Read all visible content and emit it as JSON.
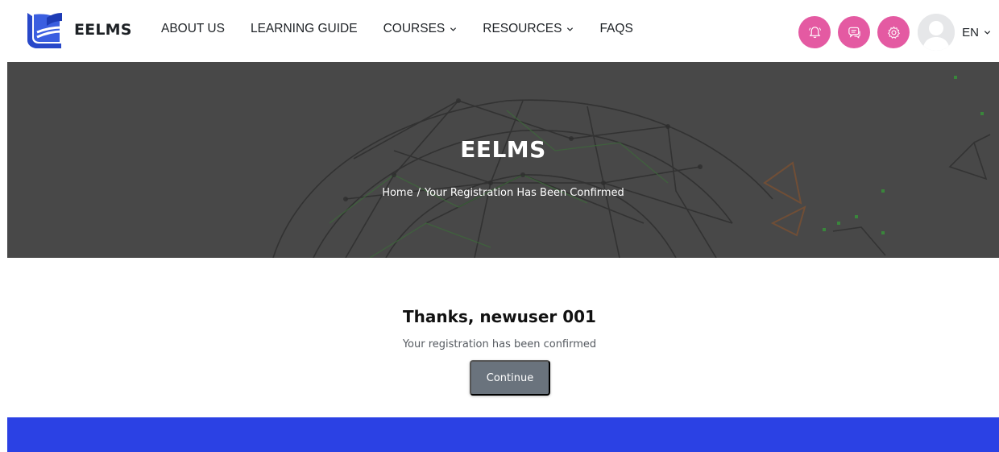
{
  "brand": {
    "name": "EELMS",
    "logo_icon": "book-logo-icon"
  },
  "nav": {
    "items": [
      {
        "label": "ABOUT US",
        "has_dropdown": false
      },
      {
        "label": "LEARNING GUIDE",
        "has_dropdown": false
      },
      {
        "label": "COURSES",
        "has_dropdown": true
      },
      {
        "label": "RESOURCES",
        "has_dropdown": true
      },
      {
        "label": "FAQS",
        "has_dropdown": false
      }
    ],
    "icons": [
      "notification-bell-icon",
      "messages-icon",
      "settings-gear-icon"
    ],
    "language": "EN"
  },
  "hero": {
    "title": "EELMS",
    "breadcrumb": {
      "home": "Home",
      "separator": "/",
      "current": "Your Registration Has Been Confirmed"
    }
  },
  "main": {
    "title": "Thanks, newuser 001",
    "message": "Your registration has been confirmed",
    "continue_label": "Continue"
  },
  "colors": {
    "accent_pink": "#e45aa2",
    "footer_blue": "#2b41e4",
    "button_gray": "#6a737d",
    "hero_bg": "#4f4f4f"
  }
}
